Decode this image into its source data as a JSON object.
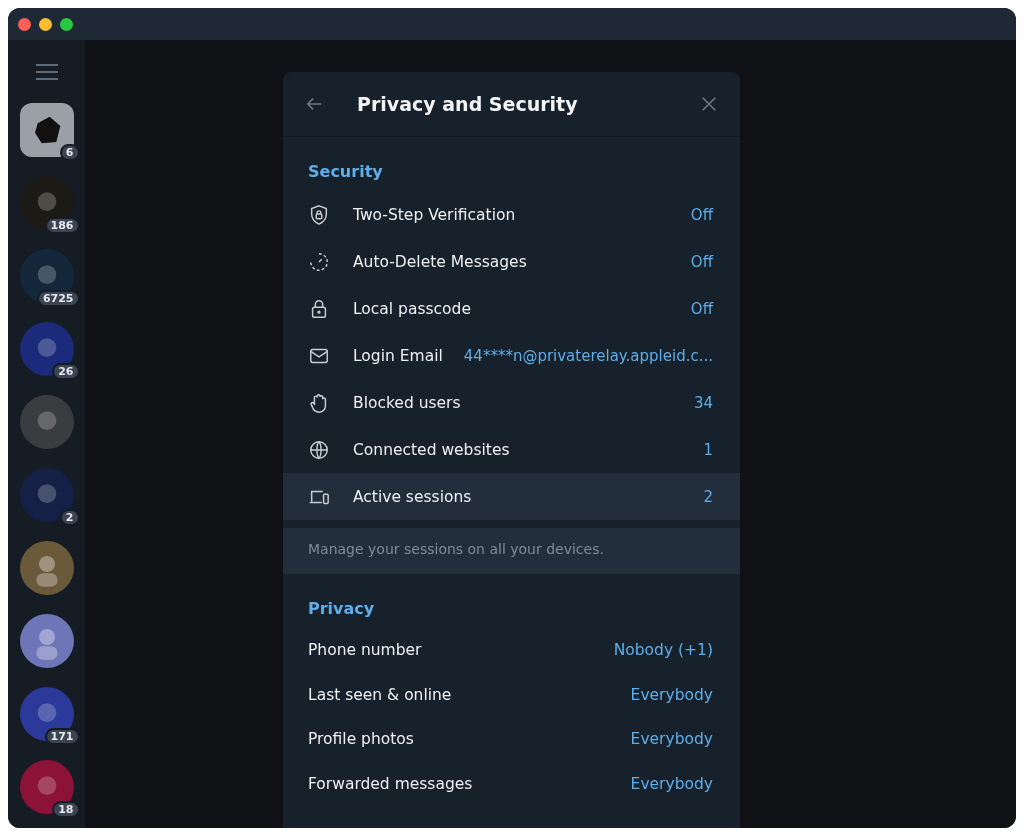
{
  "sidebar": {
    "avatars": [
      {
        "color": "#9aa0a6",
        "badge": "6",
        "kind": "rounded"
      },
      {
        "color": "#1c1a14",
        "badge": "186",
        "kind": "circle"
      },
      {
        "color": "#13283a",
        "badge": "6725",
        "kind": "circle"
      },
      {
        "color": "#1b2a7a",
        "badge": "26",
        "kind": "circle"
      },
      {
        "color": "#3a3d40",
        "kind": "circle"
      },
      {
        "color": "#152046",
        "badge": "2",
        "kind": "circle"
      },
      {
        "color": "#6b5a3a",
        "kind": "circle"
      },
      {
        "color": "#6f76b8",
        "kind": "circle"
      },
      {
        "color": "#2b3a9a",
        "badge": "171",
        "kind": "circle"
      },
      {
        "color": "#8c1238",
        "badge": "18",
        "kind": "circle"
      }
    ]
  },
  "dialog": {
    "title": "Privacy and Security",
    "security": {
      "heading": "Security",
      "items": [
        {
          "label": "Two-Step Verification",
          "value": "Off",
          "selected": false
        },
        {
          "label": "Auto-Delete Messages",
          "value": "Off",
          "selected": false
        },
        {
          "label": "Local passcode",
          "value": "Off",
          "selected": false
        },
        {
          "label": "Login Email",
          "value": "44****n@privaterelay.appleid.c...",
          "selected": false
        },
        {
          "label": "Blocked users",
          "value": "34",
          "selected": false
        },
        {
          "label": "Connected websites",
          "value": "1",
          "selected": false
        },
        {
          "label": "Active sessions",
          "value": "2",
          "selected": true
        }
      ],
      "note": "Manage your sessions on all your devices."
    },
    "privacy": {
      "heading": "Privacy",
      "items": [
        {
          "label": "Phone number",
          "value": "Nobody (+1)"
        },
        {
          "label": "Last seen & online",
          "value": "Everybody"
        },
        {
          "label": "Profile photos",
          "value": "Everybody"
        },
        {
          "label": "Forwarded messages",
          "value": "Everybody"
        }
      ]
    }
  }
}
